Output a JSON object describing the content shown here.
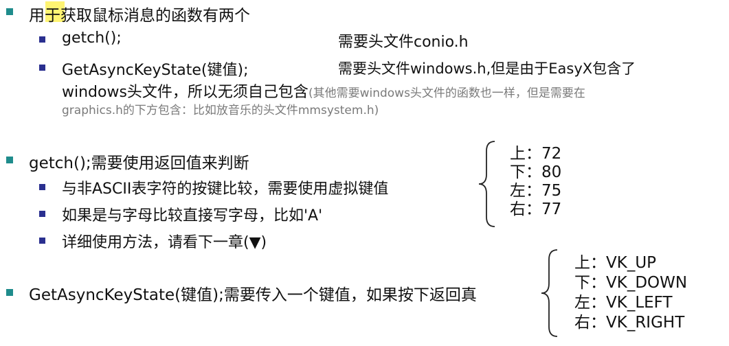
{
  "section1": {
    "heading": "用于获取鼠标消息的函数有两个",
    "item_getch": {
      "func": "getch();",
      "desc": "需要头文件conio.h"
    },
    "item_async": {
      "func": "GetAsyncKeyState(键值);",
      "desc": "需要头文件windows.h,但是由于EasyX包含了",
      "cont": "windows头文件，所以无须自己包含",
      "note1": "(其他需要windows头文件的函数也一样，但是需要在",
      "note2": "graphics.h的下方包含：比如放音乐的头文件mmsystem.h)"
    }
  },
  "section2": {
    "heading": "getch();需要使用返回值来判断",
    "items": [
      "与非ASCII表字符的按键比较，需要使用虚拟键值",
      "如果是与字母比较直接写字母，比如'A'",
      "详细使用方法，请看下一章(▼)"
    ],
    "codes": [
      "上：72",
      "下：80",
      "左：75",
      "右：77"
    ]
  },
  "section3": {
    "heading": "GetAsyncKeyState(键值);需要传入一个键值，如果按下返回真",
    "codes": [
      "上：VK_UP",
      "下：VK_DOWN",
      "左：VK_LEFT",
      "右：VK_RIGHT"
    ]
  },
  "colors": {
    "bullet_level1": "#1f8c8c",
    "bullet_level2": "#2a2f8f",
    "note": "#7a7a7a",
    "highlight": "#fff25a"
  }
}
